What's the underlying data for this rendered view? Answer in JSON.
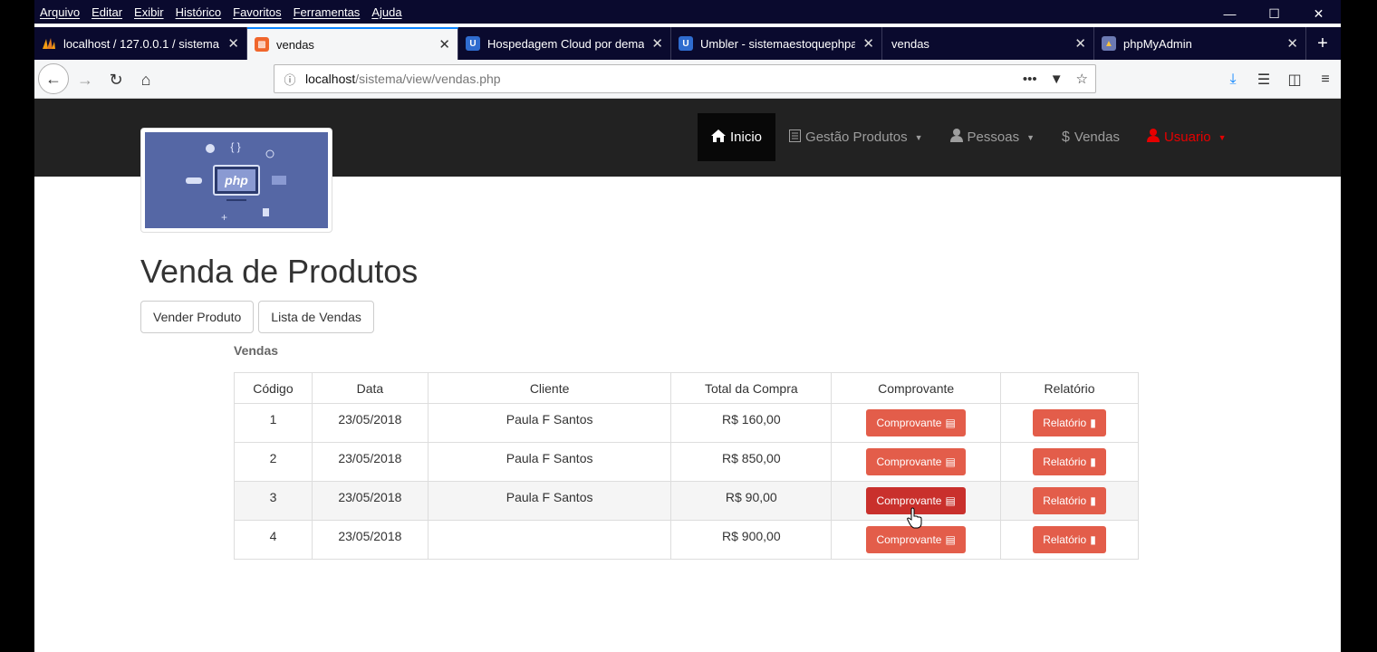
{
  "menubar": {
    "items": [
      "Arquivo",
      "Editar",
      "Exibir",
      "Histórico",
      "Favoritos",
      "Ferramentas",
      "Ajuda"
    ]
  },
  "tabs": [
    {
      "label": "localhost / 127.0.0.1 / sistema",
      "icon": "phpmyadmin-icon",
      "active": false
    },
    {
      "label": "vendas",
      "icon": "page-icon",
      "active": true
    },
    {
      "label": "Hospedagem Cloud por dema",
      "icon": "umbler-icon",
      "active": false
    },
    {
      "label": "Umbler - sistemaestoquephpa",
      "icon": "umbler-icon",
      "active": false
    },
    {
      "label": "vendas",
      "icon": "",
      "active": false
    },
    {
      "label": "phpMyAdmin",
      "icon": "phpmyadmin-icon",
      "active": false
    }
  ],
  "urlbar": {
    "host": "localhost",
    "path": "/sistema/view/vendas.php"
  },
  "sitenav": {
    "items": [
      {
        "label": "Inicio",
        "icon": "home-icon",
        "active": true,
        "dropdown": false
      },
      {
        "label": "Gestão Produtos",
        "icon": "list-icon",
        "active": false,
        "dropdown": true
      },
      {
        "label": "Pessoas",
        "icon": "user-icon",
        "active": false,
        "dropdown": true
      },
      {
        "label": "Vendas",
        "icon": "dollar-icon",
        "active": false,
        "dropdown": false
      },
      {
        "label": "Usuario",
        "icon": "user-icon",
        "active": false,
        "dropdown": true
      }
    ]
  },
  "logo": {
    "text": "php"
  },
  "main": {
    "title": "Venda de Produtos",
    "buttons": [
      "Vender Produto",
      "Lista de Vendas"
    ],
    "section_label": "Vendas",
    "table": {
      "headers": [
        "Código",
        "Data",
        "Cliente",
        "Total da Compra",
        "Comprovante",
        "Relatório"
      ],
      "rows": [
        {
          "codigo": "1",
          "data": "23/05/2018",
          "cliente": "Paula F Santos",
          "total": "R$ 160,00",
          "comprovante": "Comprovante",
          "relatorio": "Relatório"
        },
        {
          "codigo": "2",
          "data": "23/05/2018",
          "cliente": "Paula F Santos",
          "total": "R$ 850,00",
          "comprovante": "Comprovante",
          "relatorio": "Relatório"
        },
        {
          "codigo": "3",
          "data": "23/05/2018",
          "cliente": "Paula F Santos",
          "total": "R$ 90,00",
          "comprovante": "Comprovante",
          "relatorio": "Relatório"
        },
        {
          "codigo": "4",
          "data": "23/05/2018",
          "cliente": "",
          "total": "R$ 900,00",
          "comprovante": "Comprovante",
          "relatorio": "Relatório"
        }
      ]
    }
  },
  "colors": {
    "accent_tab": "#0a84ff",
    "btn_danger": "#e35d4a",
    "btn_danger_hover": "#c9302c",
    "nav_bg": "#222222",
    "user_red": "#e60000"
  }
}
